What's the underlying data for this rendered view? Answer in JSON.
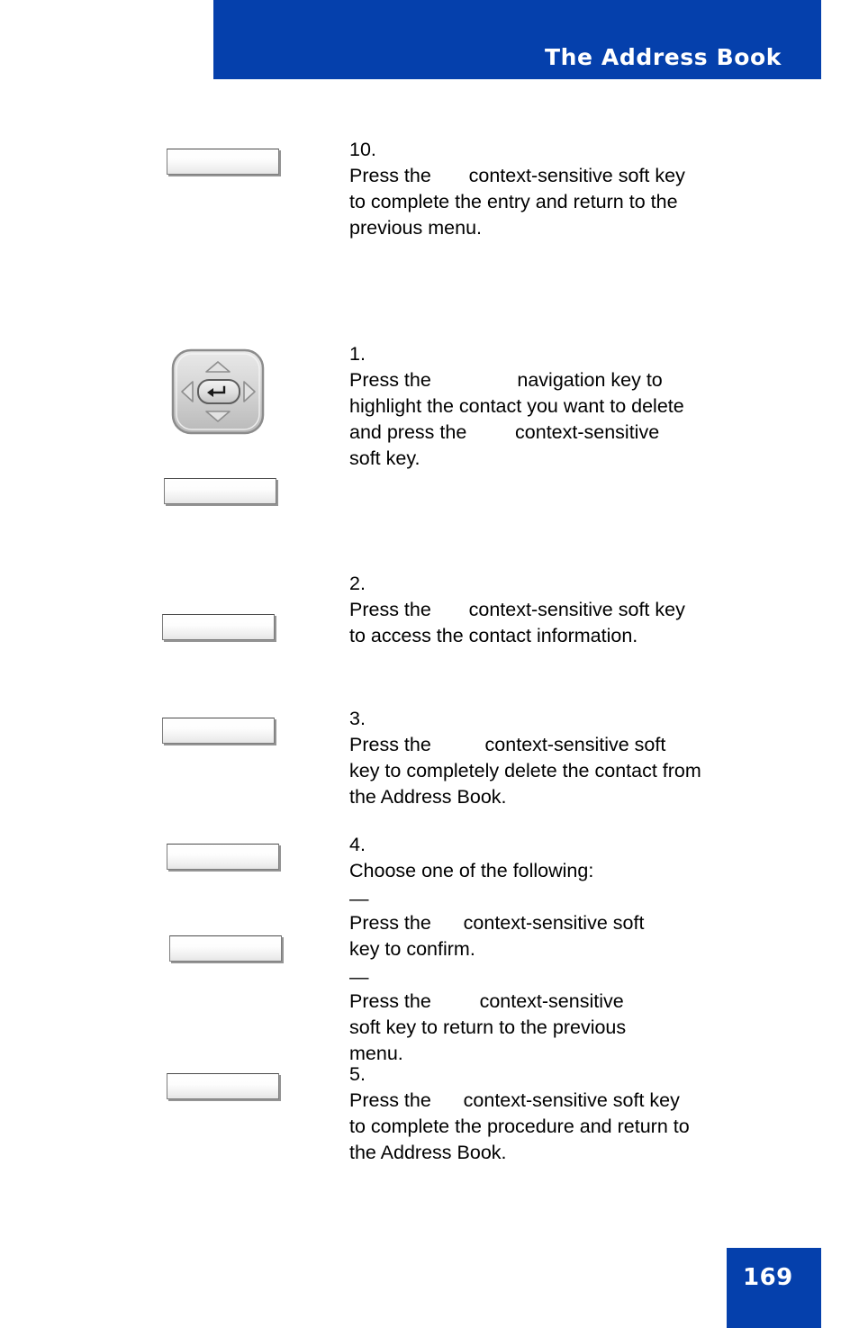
{
  "page": {
    "header_title": "The Address Book",
    "page_number": "169",
    "accent_color": "#0540ac",
    "text_color": "#000000",
    "background_color": "#ffffff"
  },
  "graphics": {
    "navigation_key": {
      "icon": "navigation-key",
      "alt": "Four-way navigation key with center enter button",
      "up_arrow": "up-arrow-icon",
      "down_arrow": "down-arrow-icon",
      "left_arrow": "left-arrow-icon",
      "right_arrow": "right-arrow-icon",
      "center": "enter-key-icon"
    },
    "soft_keys": [
      {
        "id": "softkey-step-10",
        "label": ""
      },
      {
        "id": "softkey-step-1",
        "label": ""
      },
      {
        "id": "softkey-step-2",
        "label": ""
      },
      {
        "id": "softkey-step-3",
        "label": ""
      },
      {
        "id": "softkey-step-4a",
        "label": ""
      },
      {
        "id": "softkey-step-4b",
        "label": ""
      },
      {
        "id": "softkey-step-5",
        "label": ""
      }
    ]
  },
  "steps": [
    {
      "number": "10.",
      "lines": [
        "Press the       context-sensitive soft key",
        "to complete the entry and return to the",
        "previous menu."
      ]
    },
    {
      "number": "1.",
      "lines": [
        "Press the                navigation key to",
        "highlight the contact you want to delete",
        "and press the         context-sensitive",
        "soft key."
      ]
    },
    {
      "number": "2.",
      "lines": [
        "Press the       context-sensitive soft key",
        "to access the contact information."
      ]
    },
    {
      "number": "3.",
      "lines": [
        "Press the          context-sensitive soft",
        "key to completely delete the contact from",
        "the Address Book."
      ]
    },
    {
      "number": "4.",
      "lines": [
        "Choose one of the following:"
      ],
      "sub_items": [
        {
          "dash": "—",
          "lines": [
            "Press the      context-sensitive soft",
            "key to confirm."
          ]
        },
        {
          "dash": "—",
          "lines": [
            "Press the         context-sensitive",
            "soft key to return to the previous",
            "menu."
          ]
        }
      ]
    },
    {
      "number": "5.",
      "lines": [
        "Press the      context-sensitive soft key",
        "to complete the procedure and return to",
        "the Address Book."
      ]
    }
  ]
}
